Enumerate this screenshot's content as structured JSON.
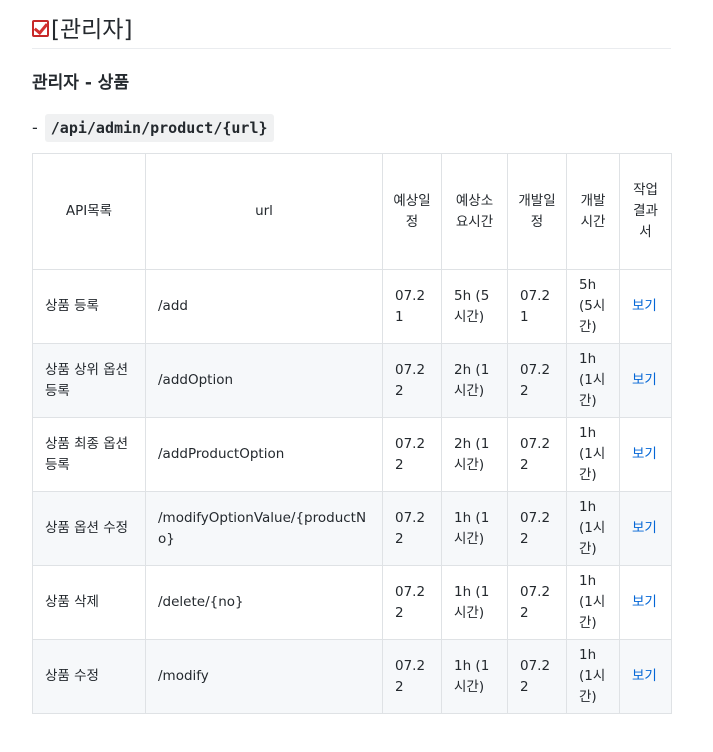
{
  "page": {
    "title": "[관리자]",
    "section_heading": "관리자 - 상품",
    "endpoint_dash": "-",
    "endpoint": "/api/admin/product/{url}"
  },
  "table": {
    "headers": [
      "API목록",
      "url",
      "예상일정",
      "예상소요시간",
      "개발일정",
      "개발시간",
      "작업결과서"
    ],
    "rows": [
      {
        "api": "상품 등록",
        "url": "/add",
        "planned_date": "07.21",
        "estimated_time": "5h (5시간)",
        "dev_date": "07.21",
        "dev_time": "5h(5시간)",
        "report": "보기"
      },
      {
        "api": "상품 상위 옵션 등록",
        "url": "/addOption",
        "planned_date": "07.22",
        "estimated_time": "2h (1시간)",
        "dev_date": "07.22",
        "dev_time": "1h (1시간)",
        "report": "보기"
      },
      {
        "api": "상품 최종 옵션 등록",
        "url": "/addProductOption",
        "planned_date": "07.22",
        "estimated_time": "2h (1시간)",
        "dev_date": "07.22",
        "dev_time": "1h (1시간)",
        "report": "보기"
      },
      {
        "api": "상품 옵션 수정",
        "url": "/modifyOptionValue/{productNo}",
        "planned_date": "07.22",
        "estimated_time": "1h (1시간)",
        "dev_date": "07.22",
        "dev_time": "1h (1시간)",
        "report": "보기"
      },
      {
        "api": "상품 삭제",
        "url": "/delete/{no}",
        "planned_date": "07.22",
        "estimated_time": "1h (1시간)",
        "dev_date": "07.22",
        "dev_time": "1h (1시간)",
        "report": "보기"
      },
      {
        "api": "상품 수정",
        "url": "/modify",
        "planned_date": "07.22",
        "estimated_time": "1h (1시간)",
        "dev_date": "07.22",
        "dev_time": "1h (1시간)",
        "report": "보기"
      }
    ]
  }
}
